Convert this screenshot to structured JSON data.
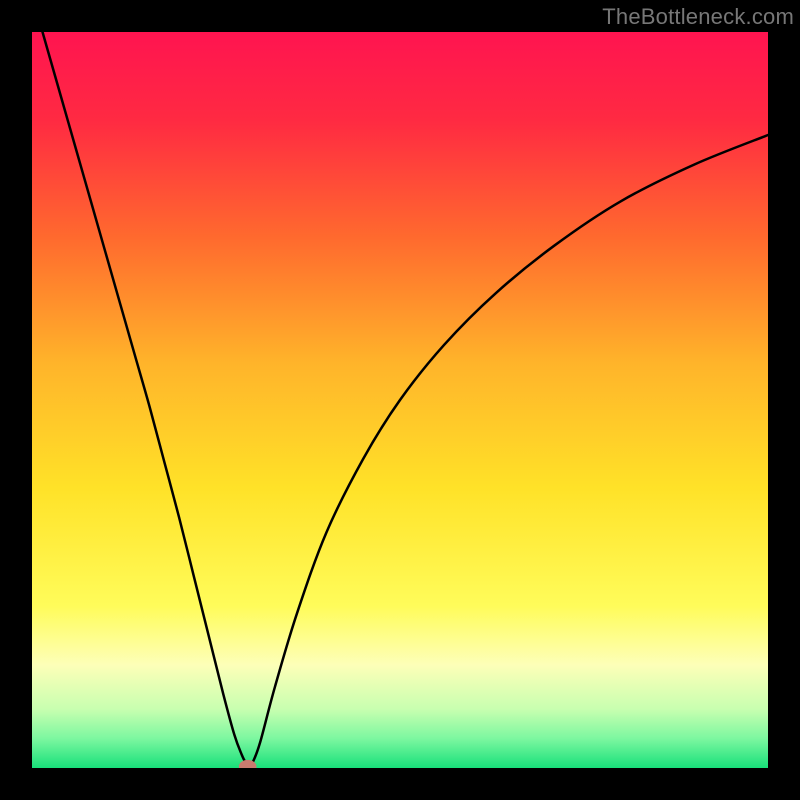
{
  "watermark": "TheBottleneck.com",
  "chart_data": {
    "type": "line",
    "title": "",
    "xlabel": "",
    "ylabel": "",
    "xlim": [
      0,
      1
    ],
    "ylim": [
      0,
      1
    ],
    "background_gradient": {
      "stops": [
        {
          "offset": 0.0,
          "color": "#ff1450"
        },
        {
          "offset": 0.12,
          "color": "#ff2a42"
        },
        {
          "offset": 0.28,
          "color": "#ff6a2e"
        },
        {
          "offset": 0.45,
          "color": "#ffb42a"
        },
        {
          "offset": 0.62,
          "color": "#ffe228"
        },
        {
          "offset": 0.78,
          "color": "#fffc5a"
        },
        {
          "offset": 0.86,
          "color": "#fdffb8"
        },
        {
          "offset": 0.92,
          "color": "#c8ffb0"
        },
        {
          "offset": 0.96,
          "color": "#7cf7a0"
        },
        {
          "offset": 1.0,
          "color": "#18e07a"
        }
      ]
    },
    "series": [
      {
        "name": "bottleneck-curve",
        "x": [
          0.0,
          0.02,
          0.04,
          0.06,
          0.08,
          0.1,
          0.12,
          0.14,
          0.16,
          0.18,
          0.2,
          0.22,
          0.24,
          0.26,
          0.275,
          0.285,
          0.29,
          0.295,
          0.3,
          0.31,
          0.33,
          0.36,
          0.4,
          0.45,
          0.5,
          0.56,
          0.63,
          0.71,
          0.8,
          0.9,
          1.0
        ],
        "y": [
          1.05,
          0.98,
          0.91,
          0.84,
          0.77,
          0.7,
          0.63,
          0.56,
          0.49,
          0.415,
          0.34,
          0.26,
          0.18,
          0.1,
          0.045,
          0.018,
          0.008,
          0.003,
          0.008,
          0.035,
          0.11,
          0.21,
          0.32,
          0.42,
          0.5,
          0.575,
          0.645,
          0.71,
          0.77,
          0.82,
          0.86
        ]
      }
    ],
    "min_point": {
      "x": 0.293,
      "y": 0.002,
      "rx": 0.012,
      "ry": 0.009,
      "color": "#c97b6f"
    }
  }
}
